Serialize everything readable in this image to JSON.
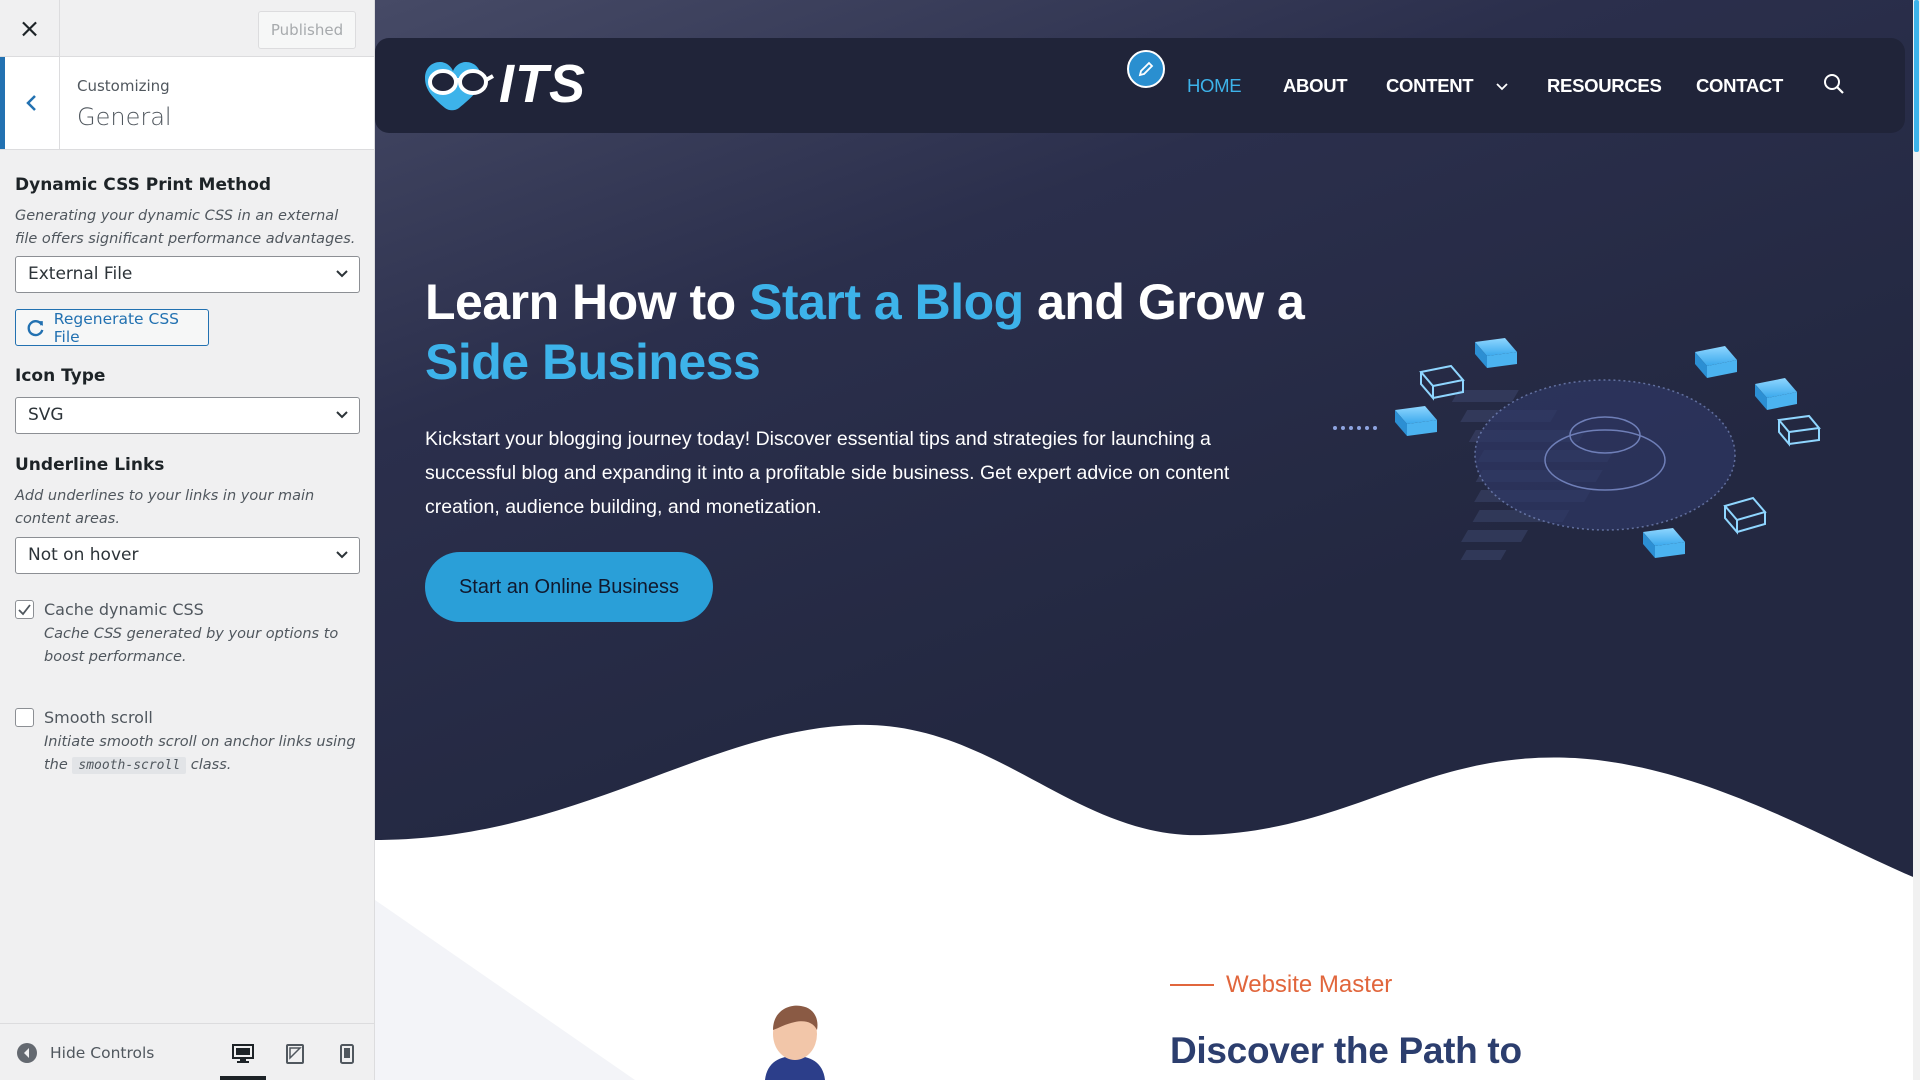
{
  "customizer": {
    "header": {
      "close_icon": "×",
      "published_label": "Published"
    },
    "section": {
      "breadcrumb": "Customizing",
      "title": "General"
    },
    "controls": {
      "css_print_method": {
        "title": "Dynamic CSS Print Method",
        "description": "Generating your dynamic CSS in an external file offers significant performance advantages.",
        "value": "External File"
      },
      "regenerate_button": "Regenerate CSS File",
      "icon_type": {
        "title": "Icon Type",
        "value": "SVG"
      },
      "underline_links": {
        "title": "Underline Links",
        "description": "Add underlines to your links in your main content areas.",
        "value": "Not on hover"
      },
      "cache_css": {
        "label": "Cache dynamic CSS",
        "description": "Cache CSS generated by your options to boost performance.",
        "checked": true
      },
      "smooth_scroll": {
        "label": "Smooth scroll",
        "description_before": "Initiate smooth scroll on anchor links using the",
        "code": "smooth-scroll",
        "description_after": "class.",
        "checked": false
      }
    },
    "footer": {
      "hide_controls_label": "Hide Controls",
      "devices": [
        "desktop-icon",
        "tablet-icon",
        "mobile-icon"
      ],
      "active_device": "desktop"
    }
  },
  "site": {
    "logo_text": "ITS",
    "nav": [
      {
        "label": "HOME",
        "active": true
      },
      {
        "label": "ABOUT",
        "active": false
      },
      {
        "label": "CONTENT",
        "active": false,
        "has_dropdown": true
      },
      {
        "label": "RESOURCES",
        "active": false
      },
      {
        "label": "CONTACT",
        "active": false
      }
    ],
    "hero": {
      "title_part1": "Learn How to ",
      "title_hl1": "Start a Blog",
      "title_part2": " and Grow a ",
      "title_hl2": "Side Business",
      "description": "Kickstart your blogging journey today! Discover essential tips and strategies for launching a successful blog and expanding it into a profitable side business. Get expert advice on content creation, audience building, and monetization.",
      "cta_label": "Start an Online Business"
    },
    "next_section": {
      "eyebrow": "Website Master",
      "title": "Discover the Path to"
    }
  },
  "colors": {
    "accent": "#3db3ea",
    "hero_dark": "#232841",
    "nav_bg": "#202439",
    "eyebrow": "#e1663c",
    "wp_blue": "#2271b1"
  }
}
